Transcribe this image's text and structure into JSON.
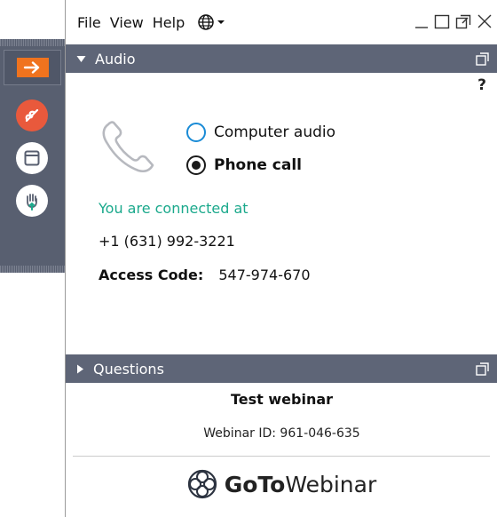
{
  "menu": {
    "file": "File",
    "view": "View",
    "help": "Help"
  },
  "sidebar": {
    "buttons": [
      {
        "icon": "arrow-right-icon",
        "color": "#f0731e"
      },
      {
        "icon": "hangup-phone-icon",
        "color": "#e9593c"
      },
      {
        "icon": "window-icon",
        "color": "#ffffff"
      },
      {
        "icon": "raise-hand-icon",
        "color": "#ffffff"
      }
    ]
  },
  "audio": {
    "title": "Audio",
    "help": "?",
    "options": [
      {
        "label": "Computer audio",
        "selected": false
      },
      {
        "label": "Phone call",
        "selected": true
      }
    ],
    "connected_text": "You are connected at",
    "phone_number": "+1 (631) 992-3221",
    "access_code_label": "Access Code:",
    "access_code": "547-974-670"
  },
  "questions": {
    "title": "Questions"
  },
  "webinar": {
    "title": "Test webinar",
    "id_text": "Webinar ID: 961-046-635"
  },
  "brand": {
    "goto": "GoTo",
    "webinar": "Webinar"
  },
  "colors": {
    "panel_header": "#5e6577",
    "sidebar_bg": "#585f70",
    "connected_green": "#1ba98c",
    "radio_blue": "#1a8bd6"
  }
}
